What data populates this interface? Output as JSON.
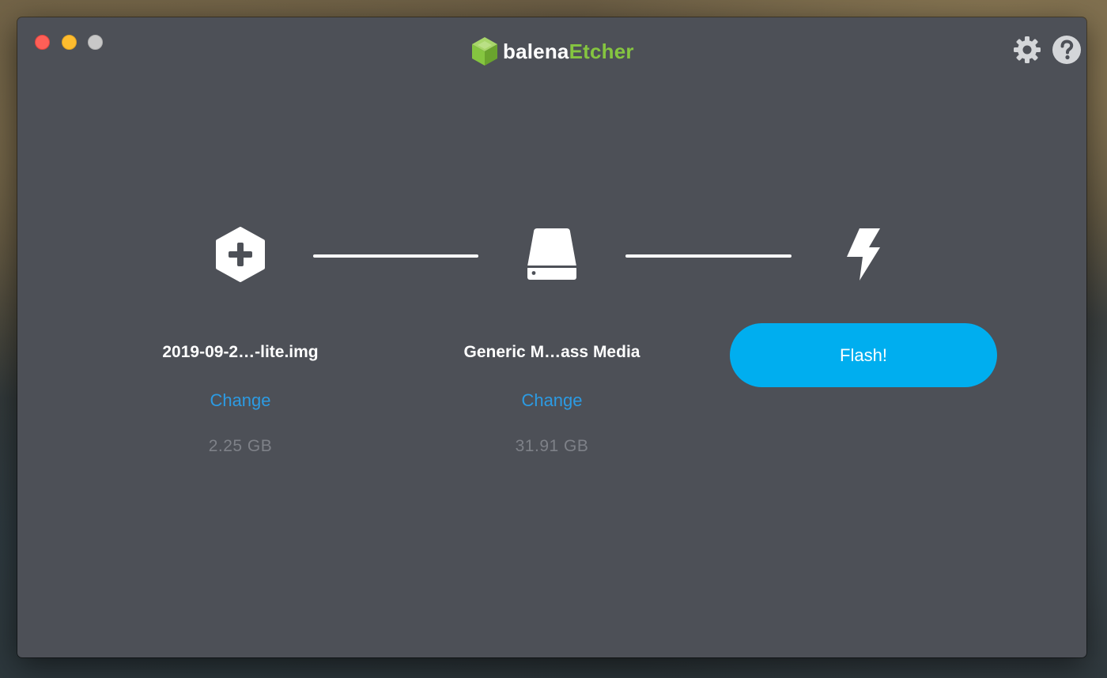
{
  "window": {
    "controls": [
      "close",
      "minimize",
      "maximize"
    ]
  },
  "header": {
    "brand_prefix": "balena",
    "brand_suffix": "Etcher",
    "brand_color": "#85c540",
    "settings_icon": "gear-icon",
    "help_icon": "question-mark-icon"
  },
  "steps": {
    "image": {
      "icon": "add-image-hexagon-icon",
      "filename": "2019-09-2…-lite.img",
      "change_label": "Change",
      "size": "2.25 GB"
    },
    "drive": {
      "icon": "drive-icon",
      "name": "Generic M…ass Media",
      "change_label": "Change",
      "size": "31.91 GB"
    },
    "flash": {
      "icon": "lightning-bolt-icon",
      "button_label": "Flash!",
      "button_color": "#00aeef"
    }
  },
  "colors": {
    "window_background": "#4d5057",
    "link": "#2c9be3",
    "muted_text": "#7e8188"
  }
}
